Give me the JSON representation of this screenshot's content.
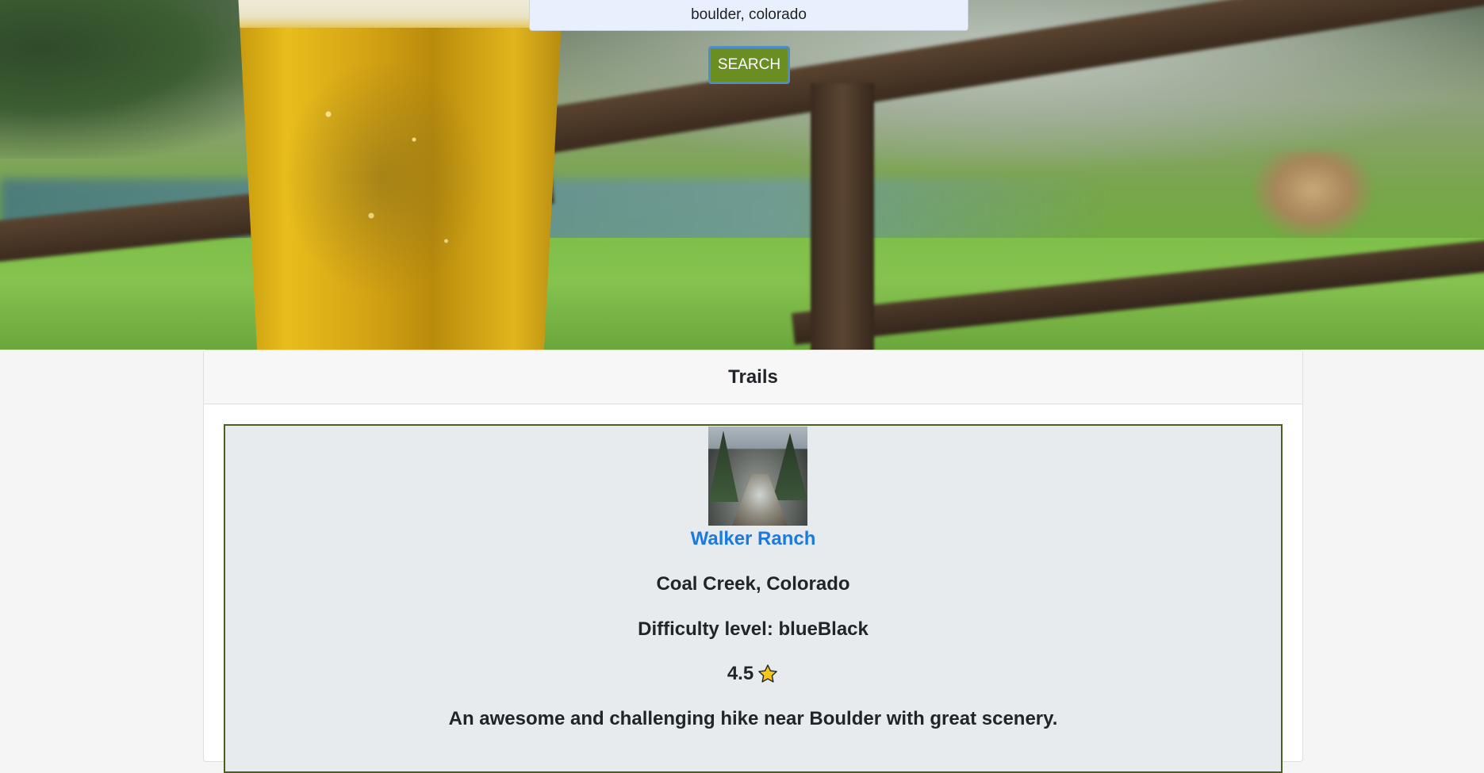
{
  "search": {
    "value": "boulder, colorado",
    "button_label": "SEARCH"
  },
  "trails": {
    "heading": "Trails",
    "items": [
      {
        "name": "Walker Ranch",
        "location": "Coal Creek, Colorado",
        "difficulty": "Difficulty level: blueBlack",
        "rating": "4.5",
        "rating_icon": "star-icon",
        "summary": "An awesome and challenging hike near Boulder with great scenery."
      }
    ]
  },
  "colors": {
    "search_button": "#6b8e23",
    "trail_border": "#4b5f1e",
    "trail_link": "#1a7ae0",
    "trail_item_bg": "#e8ebee",
    "star_fill": "#f5c518"
  }
}
